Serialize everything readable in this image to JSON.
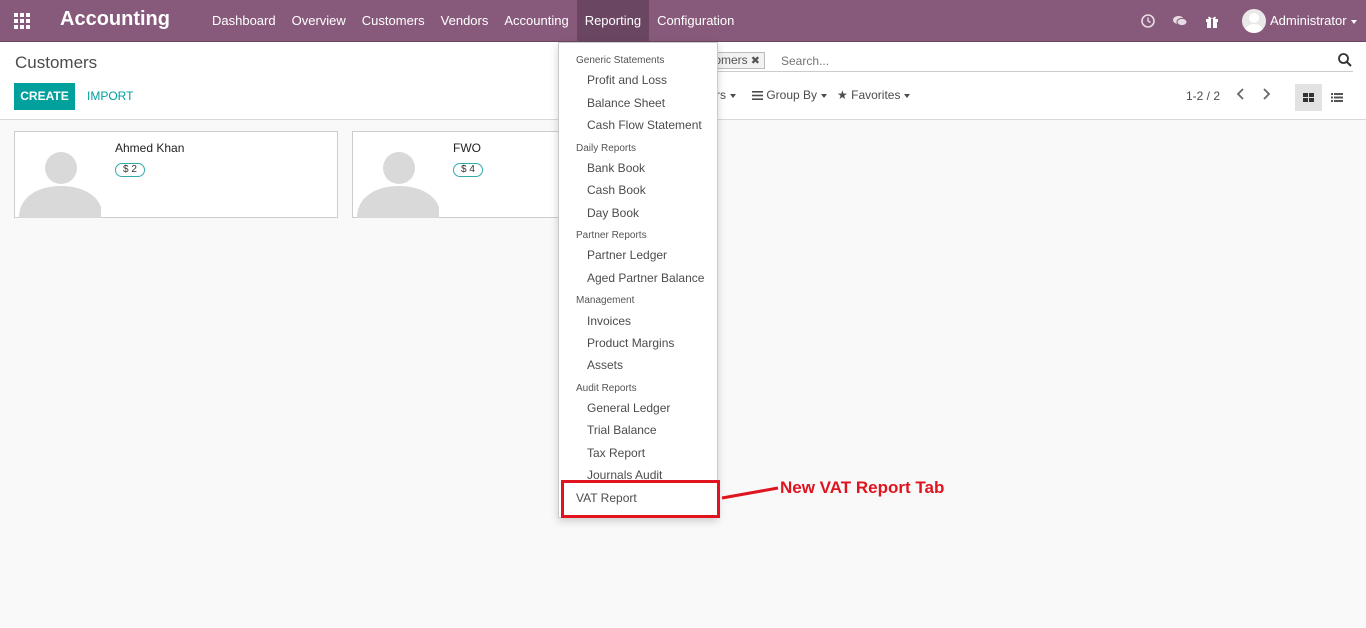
{
  "navbar": {
    "app_title": "Accounting",
    "menu": [
      "Dashboard",
      "Overview",
      "Customers",
      "Vendors",
      "Accounting",
      "Reporting",
      "Configuration"
    ],
    "active_menu": "Reporting",
    "user_name": "Administrator",
    "icons": [
      "apps-grid-icon",
      "clock-icon",
      "chat-icon",
      "gift-icon",
      "avatar-icon"
    ]
  },
  "control_panel": {
    "breadcrumb": "Customers",
    "create_label": "CREATE",
    "import_label": "IMPORT",
    "search_facet": "stomers",
    "search_placeholder": "Search...",
    "filters_fragment": "rs",
    "groupby_label": "Group By",
    "favorites_label": "Favorites",
    "pager_value": "1-2 / 2"
  },
  "cards": [
    {
      "name": "Ahmed Khan",
      "badge": "$ 2"
    },
    {
      "name": "FWO",
      "badge": "$ 4"
    }
  ],
  "reporting_menu": {
    "sections": [
      {
        "header": "Generic Statements",
        "items": [
          "Profit and Loss",
          "Balance Sheet",
          "Cash Flow Statement"
        ]
      },
      {
        "header": "Daily Reports",
        "items": [
          "Bank Book",
          "Cash Book",
          "Day Book"
        ]
      },
      {
        "header": "Partner Reports",
        "items": [
          "Partner Ledger",
          "Aged Partner Balance"
        ]
      },
      {
        "header": "Management",
        "items": [
          "Invoices",
          "Product Margins",
          "Assets"
        ]
      },
      {
        "header": "Audit Reports",
        "items": [
          "General Ledger",
          "Trial Balance",
          "Tax Report",
          "Journals Audit"
        ]
      }
    ],
    "extra_item": "VAT Report"
  },
  "annotation": {
    "text": "New VAT Report Tab",
    "color": "#e0141f"
  },
  "colors": {
    "navbar": "#875a7b",
    "navbar_active": "#6b4662",
    "primary": "#00a09d"
  }
}
